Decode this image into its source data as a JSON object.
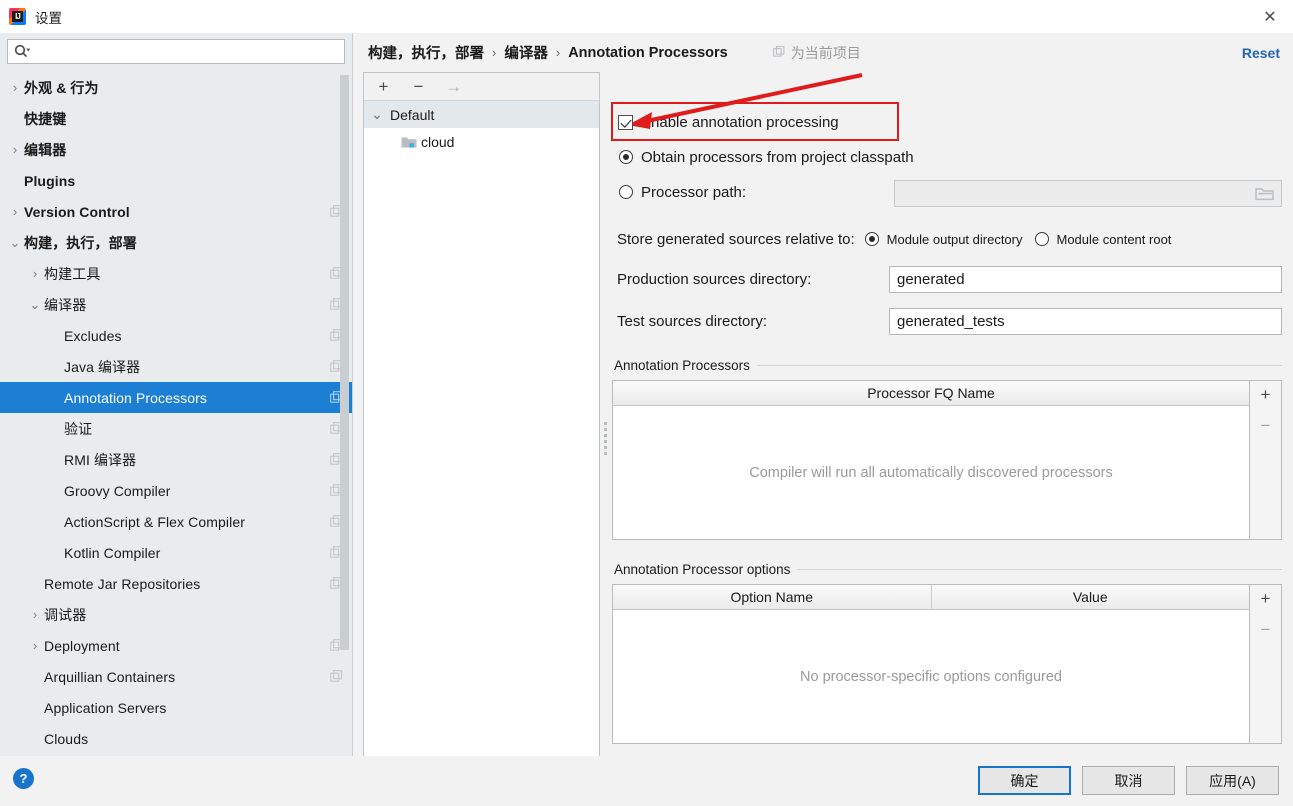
{
  "window": {
    "title": "设置",
    "logo_text": "IJ",
    "close_icon": "✕"
  },
  "sidebar": {
    "search": {
      "value": "",
      "placeholder": "",
      "icon": "search-icon"
    },
    "items": [
      {
        "label": "外观 & 行为",
        "indent": 0,
        "twisty": "›",
        "bold": true,
        "copy": false,
        "selected": false
      },
      {
        "label": "快捷键",
        "indent": 0,
        "twisty": "",
        "bold": true,
        "copy": false,
        "selected": false
      },
      {
        "label": "编辑器",
        "indent": 0,
        "twisty": "›",
        "bold": true,
        "copy": false,
        "selected": false
      },
      {
        "label": "Plugins",
        "indent": 0,
        "twisty": "",
        "bold": true,
        "copy": false,
        "selected": false
      },
      {
        "label": "Version Control",
        "indent": 0,
        "twisty": "›",
        "bold": true,
        "copy": true,
        "selected": false
      },
      {
        "label": "构建，执行，部署",
        "indent": 0,
        "twisty": "⌄",
        "bold": true,
        "copy": false,
        "selected": false
      },
      {
        "label": "构建工具",
        "indent": 1,
        "twisty": "›",
        "bold": false,
        "copy": true,
        "selected": false
      },
      {
        "label": "编译器",
        "indent": 1,
        "twisty": "⌄",
        "bold": false,
        "copy": true,
        "selected": false
      },
      {
        "label": "Excludes",
        "indent": 2,
        "twisty": "",
        "bold": false,
        "copy": true,
        "selected": false
      },
      {
        "label": "Java 编译器",
        "indent": 2,
        "twisty": "",
        "bold": false,
        "copy": true,
        "selected": false
      },
      {
        "label": "Annotation Processors",
        "indent": 2,
        "twisty": "",
        "bold": false,
        "copy": true,
        "selected": true
      },
      {
        "label": "验证",
        "indent": 2,
        "twisty": "",
        "bold": false,
        "copy": true,
        "selected": false
      },
      {
        "label": "RMI 编译器",
        "indent": 2,
        "twisty": "",
        "bold": false,
        "copy": true,
        "selected": false
      },
      {
        "label": "Groovy Compiler",
        "indent": 2,
        "twisty": "",
        "bold": false,
        "copy": true,
        "selected": false
      },
      {
        "label": "ActionScript & Flex Compiler",
        "indent": 2,
        "twisty": "",
        "bold": false,
        "copy": true,
        "selected": false
      },
      {
        "label": "Kotlin Compiler",
        "indent": 2,
        "twisty": "",
        "bold": false,
        "copy": true,
        "selected": false
      },
      {
        "label": "Remote Jar Repositories",
        "indent": 1,
        "twisty": "",
        "bold": false,
        "copy": true,
        "selected": false
      },
      {
        "label": "调试器",
        "indent": 1,
        "twisty": "›",
        "bold": false,
        "copy": false,
        "selected": false
      },
      {
        "label": "Deployment",
        "indent": 1,
        "twisty": "›",
        "bold": false,
        "copy": true,
        "selected": false
      },
      {
        "label": "Arquillian Containers",
        "indent": 1,
        "twisty": "",
        "bold": false,
        "copy": true,
        "selected": false
      },
      {
        "label": "Application Servers",
        "indent": 1,
        "twisty": "",
        "bold": false,
        "copy": false,
        "selected": false
      },
      {
        "label": "Clouds",
        "indent": 1,
        "twisty": "",
        "bold": false,
        "copy": false,
        "selected": false
      }
    ]
  },
  "header": {
    "breadcrumb": [
      "构建，执行，部署",
      "编译器",
      "Annotation Processors"
    ],
    "separator": "›",
    "scope_label": "为当前项目",
    "reset_label": "Reset"
  },
  "modules": {
    "toolbar": {
      "add": "+",
      "remove": "−",
      "move": "→"
    },
    "tree": [
      {
        "label": "Default",
        "type": "group",
        "twisty": "⌄"
      },
      {
        "label": "cloud",
        "type": "module",
        "icon": "module-folder-icon"
      }
    ]
  },
  "settings": {
    "enable_annotation_processing": {
      "label": "Enable annotation processing",
      "checked": true
    },
    "processor_source": {
      "options": [
        {
          "label": "Obtain processors from project classpath",
          "selected": true
        },
        {
          "label": "Processor path:",
          "selected": false
        }
      ],
      "processor_path_value": "",
      "browse_icon": "folder-browse-icon"
    },
    "store_relative": {
      "label": "Store generated sources relative to:",
      "options": [
        {
          "label": "Module output directory",
          "selected": true
        },
        {
          "label": "Module content root",
          "selected": false
        }
      ]
    },
    "production_sources": {
      "label": "Production sources directory:",
      "value": "generated"
    },
    "test_sources": {
      "label": "Test sources directory:",
      "value": "generated_tests"
    }
  },
  "processors_section": {
    "title": "Annotation Processors",
    "columns": [
      "Processor FQ Name"
    ],
    "rows": [],
    "empty_text": "Compiler will run all automatically discovered processors",
    "buttons": {
      "add": "+",
      "remove": "−"
    }
  },
  "options_section": {
    "title": "Annotation Processor options",
    "columns": [
      "Option Name",
      "Value"
    ],
    "rows": [],
    "empty_text": "No processor-specific options configured",
    "buttons": {
      "add": "+",
      "remove": "−"
    }
  },
  "footer": {
    "help_label": "?",
    "ok_label": "确定",
    "cancel_label": "取消",
    "apply_label": "应用(A)"
  },
  "annotation": {
    "highlight_color": "#e01b1b",
    "target": "Enable annotation processing"
  }
}
